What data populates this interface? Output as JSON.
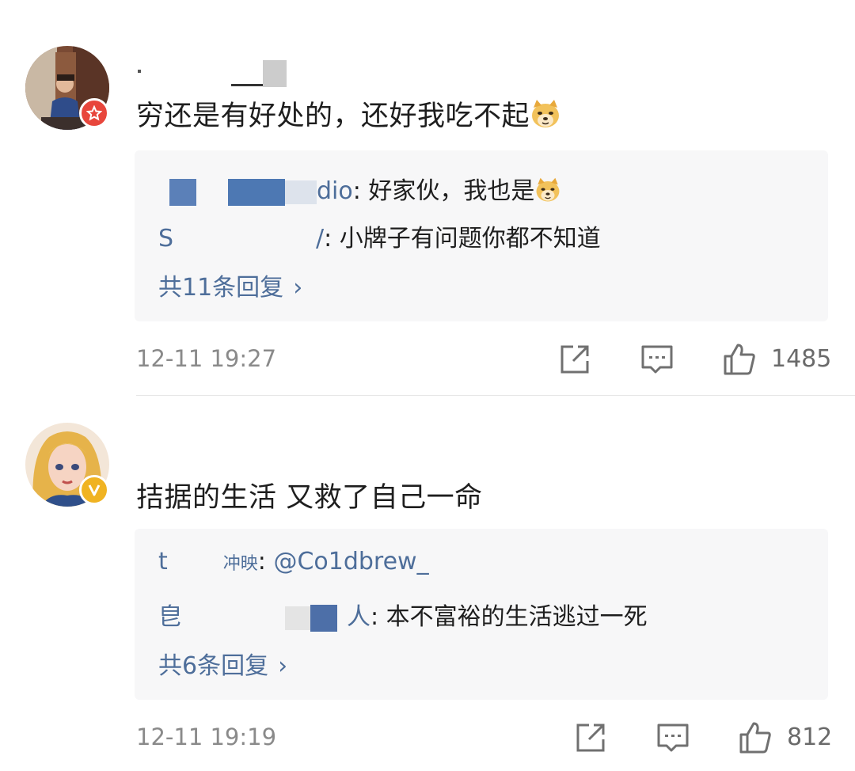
{
  "comments": [
    {
      "text": "穷还是有好处的，还好我吃不起",
      "emoji": "doge-emoji",
      "badge_color": "#e8463c",
      "replies": [
        {
          "name_visible": "dio",
          "text": ": 好家伙，我也是",
          "emoji": "doge-emoji"
        },
        {
          "name_visible": "S",
          "name_tail": "/",
          "text": ": 小牌子有问题你都不知道"
        }
      ],
      "more_replies": "共11条回复",
      "time": "12-11 19:27",
      "likes": "1485"
    },
    {
      "text": "拮据的生活 又救了自己一命",
      "badge_color": "#f0b322",
      "replies": [
        {
          "name_visible": "t",
          "name_tail": "冲映",
          "text": ": ",
          "mention": "@Co1dbrew_"
        },
        {
          "name_visible": "皀",
          "name_tail": "人",
          "text": ": 本不富裕的生活逃过一死"
        }
      ],
      "more_replies": "共6条回复",
      "time": "12-11 19:19",
      "likes": "812"
    }
  ],
  "colors": {
    "link": "#4e6e9a",
    "reply_bg": "#f7f7f8",
    "meta_text": "#8a8a8a"
  }
}
